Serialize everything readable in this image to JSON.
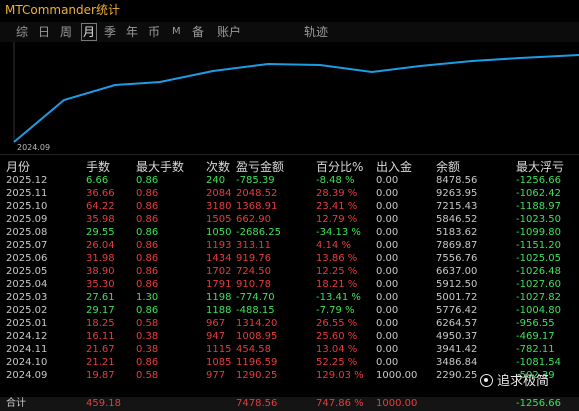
{
  "title": "MTCommander统计",
  "tabs": [
    {
      "label": "综",
      "active": false
    },
    {
      "label": "日",
      "active": false
    },
    {
      "label": "周",
      "active": false
    },
    {
      "label": "月",
      "active": true
    },
    {
      "label": "季",
      "active": false
    },
    {
      "label": "年",
      "active": false
    },
    {
      "label": "币",
      "active": false
    },
    {
      "label": "M",
      "active": false
    },
    {
      "label": "备",
      "active": false
    },
    {
      "label": "账户",
      "active": false
    },
    {
      "label": "轨迹",
      "active": false
    }
  ],
  "chart": {
    "x_label": "2024.09",
    "line_color": "#1e9be6"
  },
  "columns": [
    "月份",
    "手数",
    "最大手数",
    "次数",
    "盈亏金额",
    "百分比%",
    "出入金",
    "余额",
    "最大浮亏"
  ],
  "rows": [
    {
      "month": "2025.12",
      "lots": "6.66",
      "max_lots": "0.86",
      "count": "240",
      "pnl": "-785.39",
      "pct": "-8.48 %",
      "inout": "0.00",
      "balance": "8478.56",
      "max_dd": "-1256.66",
      "color": "green"
    },
    {
      "month": "2025.11",
      "lots": "36.66",
      "max_lots": "0.86",
      "count": "2084",
      "pnl": "2048.52",
      "pct": "28.39 %",
      "inout": "0.00",
      "balance": "9263.95",
      "max_dd": "-1062.42",
      "color": "red"
    },
    {
      "month": "2025.10",
      "lots": "64.22",
      "max_lots": "0.86",
      "count": "3180",
      "pnl": "1368.91",
      "pct": "23.41 %",
      "inout": "0.00",
      "balance": "7215.43",
      "max_dd": "-1188.97",
      "color": "red"
    },
    {
      "month": "2025.09",
      "lots": "35.98",
      "max_lots": "0.86",
      "count": "1505",
      "pnl": "662.90",
      "pct": "12.79 %",
      "inout": "0.00",
      "balance": "5846.52",
      "max_dd": "-1023.50",
      "color": "red"
    },
    {
      "month": "2025.08",
      "lots": "29.55",
      "max_lots": "0.86",
      "count": "1050",
      "pnl": "-2686.25",
      "pct": "-34.13 %",
      "inout": "0.00",
      "balance": "5183.62",
      "max_dd": "-1099.80",
      "color": "green"
    },
    {
      "month": "2025.07",
      "lots": "26.04",
      "max_lots": "0.86",
      "count": "1193",
      "pnl": "313.11",
      "pct": "4.14 %",
      "inout": "0.00",
      "balance": "7869.87",
      "max_dd": "-1151.20",
      "color": "red"
    },
    {
      "month": "2025.06",
      "lots": "31.98",
      "max_lots": "0.86",
      "count": "1434",
      "pnl": "919.76",
      "pct": "13.86 %",
      "inout": "0.00",
      "balance": "7556.76",
      "max_dd": "-1025.05",
      "color": "red"
    },
    {
      "month": "2025.05",
      "lots": "38.90",
      "max_lots": "0.86",
      "count": "1702",
      "pnl": "724.50",
      "pct": "12.25 %",
      "inout": "0.00",
      "balance": "6637.00",
      "max_dd": "-1026.48",
      "color": "red"
    },
    {
      "month": "2025.04",
      "lots": "35.30",
      "max_lots": "0.86",
      "count": "1791",
      "pnl": "910.78",
      "pct": "18.21 %",
      "inout": "0.00",
      "balance": "5912.50",
      "max_dd": "-1027.60",
      "color": "red"
    },
    {
      "month": "2025.03",
      "lots": "27.61",
      "max_lots": "1.30",
      "count": "1198",
      "pnl": "-774.70",
      "pct": "-13.41 %",
      "inout": "0.00",
      "balance": "5001.72",
      "max_dd": "-1027.82",
      "color": "green"
    },
    {
      "month": "2025.02",
      "lots": "29.17",
      "max_lots": "0.86",
      "count": "1188",
      "pnl": "-488.15",
      "pct": "-7.79 %",
      "inout": "0.00",
      "balance": "5776.42",
      "max_dd": "-1004.80",
      "color": "green"
    },
    {
      "month": "2025.01",
      "lots": "18.25",
      "max_lots": "0.58",
      "count": "967",
      "pnl": "1314.20",
      "pct": "26.55 %",
      "inout": "0.00",
      "balance": "6264.57",
      "max_dd": "-956.55",
      "color": "red"
    },
    {
      "month": "2024.12",
      "lots": "16.11",
      "max_lots": "0.38",
      "count": "947",
      "pnl": "1008.95",
      "pct": "25.60 %",
      "inout": "0.00",
      "balance": "4950.37",
      "max_dd": "-469.17",
      "color": "red"
    },
    {
      "month": "2024.11",
      "lots": "21.67",
      "max_lots": "0.38",
      "count": "1115",
      "pnl": "454.58",
      "pct": "13.04 %",
      "inout": "0.00",
      "balance": "3941.42",
      "max_dd": "-782.11",
      "color": "red"
    },
    {
      "month": "2024.10",
      "lots": "21.21",
      "max_lots": "0.86",
      "count": "1085",
      "pnl": "1196.59",
      "pct": "52.25 %",
      "inout": "0.00",
      "balance": "3486.84",
      "max_dd": "-1081.54",
      "color": "red"
    },
    {
      "month": "2024.09",
      "lots": "19.87",
      "max_lots": "0.58",
      "count": "977",
      "pnl": "1290.25",
      "pct": "129.03 %",
      "inout": "1000.00",
      "balance": "2290.25",
      "max_dd": "-502.39",
      "color": "red"
    }
  ],
  "total": {
    "label": "合计",
    "lots": "459.18",
    "count": "",
    "pnl": "7478.56",
    "pct": "747.86 %",
    "inout": "1000.00",
    "max_dd": "-1256.66"
  },
  "watermark": "追求极简"
}
